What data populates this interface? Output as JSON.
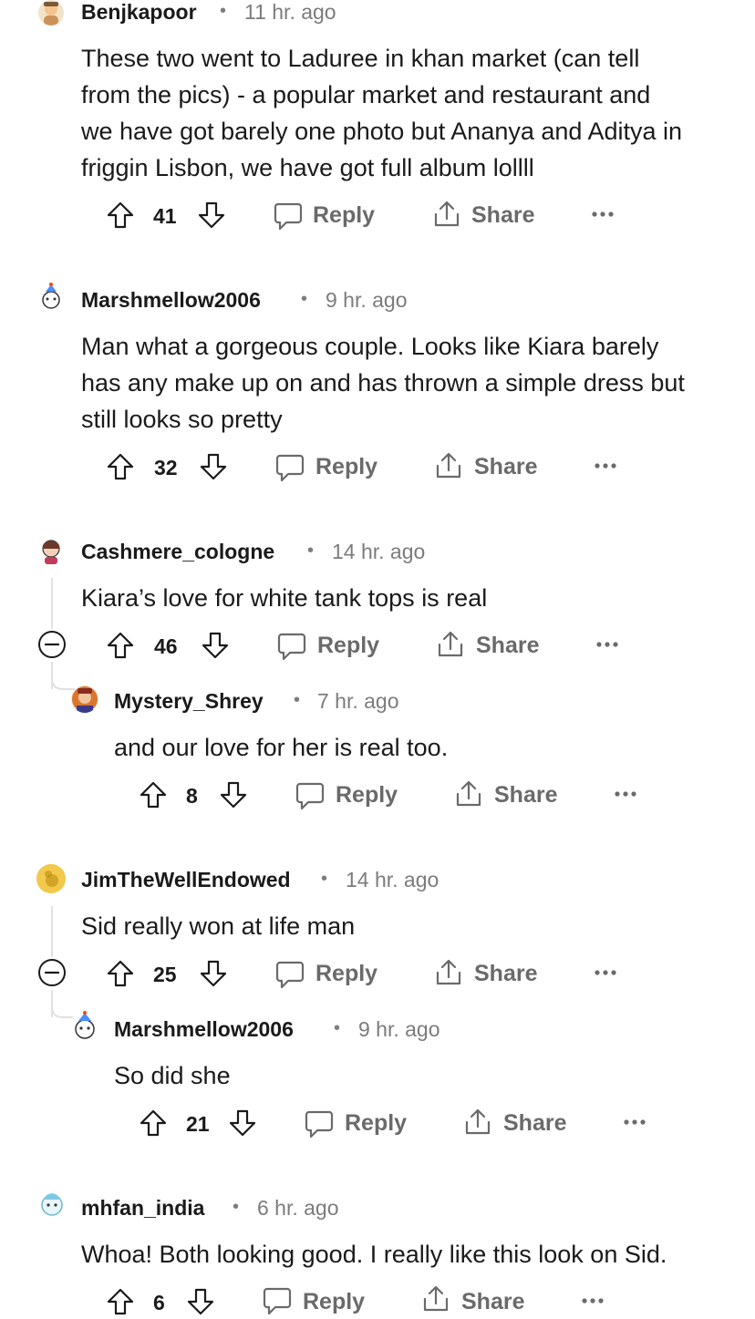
{
  "colors": {
    "text": "#1a1a1b",
    "meta": "#7c7c7c",
    "action": "#6a6a6a",
    "thread_line": "#e0e0e0"
  },
  "actions": {
    "reply": "Reply",
    "share": "Share"
  },
  "comments": [
    {
      "username": "Benjkapoor",
      "time": "11 hr. ago",
      "lines": [
        "These two went to Laduree in khan market (can tell",
        "from the pics) - a popular market and restaurant and",
        "we have got barely one photo but Ananya and Aditya in",
        "friggin Lisbon, we have got full album lollll"
      ],
      "votes": "41"
    },
    {
      "username": "Marshmellow2006",
      "time": "9 hr. ago",
      "lines": [
        "Man what a gorgeous couple. Looks like Kiara barely",
        "has any make up on and has thrown a simple dress but",
        "still looks so pretty"
      ],
      "votes": "32"
    },
    {
      "username": "Cashmere_cologne",
      "time": "14 hr. ago",
      "lines": [
        "Kiara’s love for white tank tops is real"
      ],
      "votes": "46"
    },
    {
      "username": "Mystery_Shrey",
      "time": "7 hr. ago",
      "lines": [
        "and our love for her is real too."
      ],
      "votes": "8"
    },
    {
      "username": "JimTheWellEndowed",
      "time": "14 hr. ago",
      "lines": [
        "Sid really won at life man"
      ],
      "votes": "25"
    },
    {
      "username": "Marshmellow2006",
      "time": "9 hr. ago",
      "lines": [
        "So did she"
      ],
      "votes": "21"
    },
    {
      "username": "mhfan_india",
      "time": "6 hr. ago",
      "lines": [
        "Whoa! Both looking good. I really like this look on Sid."
      ],
      "votes": "6"
    }
  ]
}
